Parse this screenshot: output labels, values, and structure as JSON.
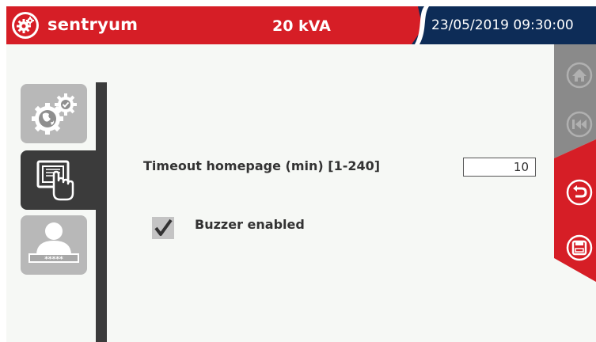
{
  "header": {
    "brand": "sentryum",
    "rating": "20 kVA",
    "datetime": "23/05/2019 09:30:00",
    "colors": {
      "red": "#d61e26",
      "navy": "#0d2c57"
    }
  },
  "nav": {
    "items": [
      {
        "icon": "gear-globe-icon",
        "active": false
      },
      {
        "icon": "touch-display-icon",
        "active": true
      },
      {
        "icon": "user-password-icon",
        "active": false,
        "password_mask": "*****"
      }
    ]
  },
  "settings": {
    "timeout_label": "Timeout homepage (min) [1-240]",
    "timeout_value": "10",
    "buzzer_label": "Buzzer enabled",
    "buzzer_checked": true
  },
  "side_actions": {
    "icons": [
      "home-icon",
      "back-icon",
      "undo-icon",
      "save-icon"
    ],
    "colors": {
      "disabled": "#8a8a8a",
      "active": "#d61e26"
    }
  }
}
